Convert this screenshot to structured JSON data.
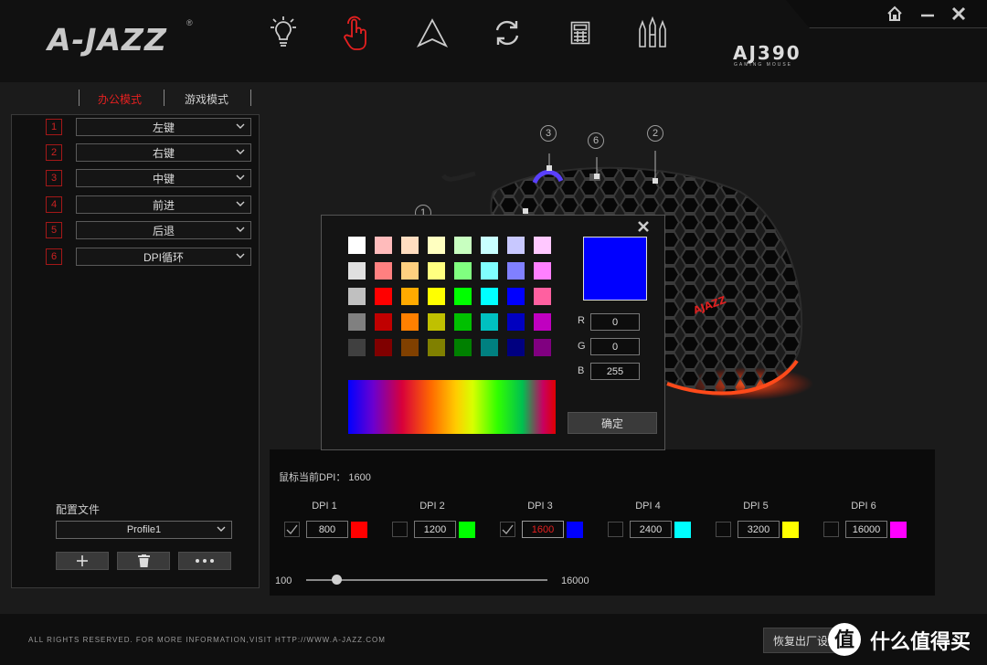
{
  "brand": {
    "logo": "A-JAZZ",
    "registered": "®"
  },
  "header": {
    "nav_icons": [
      "lighting-icon",
      "button-assign-icon",
      "dpi-icon",
      "refresh-icon",
      "macro-icon",
      "battery-icon"
    ],
    "active_nav": "button-assign-icon",
    "model": "AJ390",
    "model_sub": "GAMING MOUSE"
  },
  "window_controls": [
    "home-icon",
    "minimize-icon",
    "close-icon"
  ],
  "mode_tabs": [
    {
      "label": "办公模式",
      "active": true
    },
    {
      "label": "游戏模式",
      "active": false
    }
  ],
  "button_assignments": [
    {
      "num": "1",
      "label": "左键"
    },
    {
      "num": "2",
      "label": "右键"
    },
    {
      "num": "3",
      "label": "中键"
    },
    {
      "num": "4",
      "label": "前进"
    },
    {
      "num": "5",
      "label": "后退"
    },
    {
      "num": "6",
      "label": "DPI循环"
    }
  ],
  "profile": {
    "label": "配置文件",
    "selected": "Profile1"
  },
  "mouse_callouts": [
    "1",
    "2",
    "3",
    "6"
  ],
  "mouse_logo": "AJAZZ",
  "dpi": {
    "current_label": "鼠标当前DPI：",
    "current_value": "1600",
    "slots": [
      {
        "label": "DPI 1",
        "value": "800",
        "checked": true,
        "color": "#ff0000",
        "active": false
      },
      {
        "label": "DPI 2",
        "value": "1200",
        "checked": false,
        "color": "#00ff00",
        "active": false
      },
      {
        "label": "DPI 3",
        "value": "1600",
        "checked": true,
        "color": "#0000ff",
        "active": true
      },
      {
        "label": "DPI 4",
        "value": "2400",
        "checked": false,
        "color": "#00ffff",
        "active": false
      },
      {
        "label": "DPI 5",
        "value": "3200",
        "checked": false,
        "color": "#ffff00",
        "active": false
      },
      {
        "label": "DPI 6",
        "value": "16000",
        "checked": false,
        "color": "#ff00ff",
        "active": false
      }
    ],
    "slider_min": "100",
    "slider_max": "16000",
    "slider_fraction": 0.11
  },
  "color_picker": {
    "swatches": [
      [
        "#ffffff",
        "#ffbbbb",
        "#ffddc0",
        "#ffffc0",
        "#c8ffc0",
        "#c8ffff",
        "#c8c8ff",
        "#ffc8ff"
      ],
      [
        "#e0e0e0",
        "#ff8080",
        "#ffd080",
        "#ffff80",
        "#80ff80",
        "#80ffff",
        "#8080ff",
        "#ff80ff"
      ],
      [
        "#c0c0c0",
        "#ff0000",
        "#ffaa00",
        "#ffff00",
        "#00ff00",
        "#00ffff",
        "#0000ff",
        "#ff60a0"
      ],
      [
        "#808080",
        "#c00000",
        "#ff8000",
        "#c0c000",
        "#00c000",
        "#00c0c0",
        "#0000c0",
        "#c000c0"
      ],
      [
        "#404040",
        "#800000",
        "#804000",
        "#808000",
        "#008000",
        "#008080",
        "#000080",
        "#800080"
      ]
    ],
    "preview_color": "#0000ff",
    "r_label": "R",
    "r_value": "0",
    "g_label": "G",
    "g_value": "0",
    "b_label": "B",
    "b_value": "255",
    "confirm": "确定"
  },
  "footer": {
    "copyright": "ALL RIGHTS RESERVED. FOR MORE INFORMATION,VISIT HTTP://WWW.A-JAZZ.COM",
    "restore": "恢复出厂设置"
  },
  "watermark": "什么值得买"
}
